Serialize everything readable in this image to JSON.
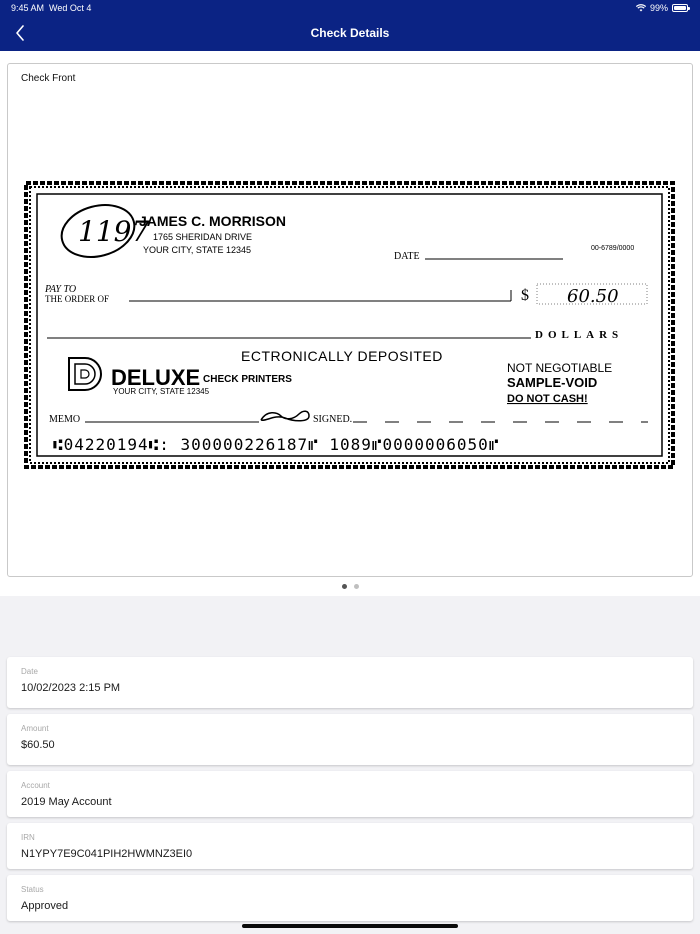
{
  "status_bar": {
    "time": "9:45 AM",
    "date": "Wed Oct 4",
    "battery": "99%"
  },
  "nav": {
    "title": "Check Details",
    "back_icon": "chevron-left-icon"
  },
  "check_image": {
    "label": "Check Front",
    "check": {
      "number": "1197",
      "name": "JAMES C. MORRISON",
      "address1": "1765 SHERIDAN DRIVE",
      "address2": "YOUR CITY, STATE  12345",
      "date_label": "DATE",
      "routing_fraction": "00-6789/0000",
      "pay_to_line1": "PAY TO",
      "pay_to_line2": "THE ORDER OF",
      "dollar_sign": "$",
      "amount": "60.50",
      "dollars_label": "DOLLARS",
      "stamp": "ECTRONICALLY DEPOSITED",
      "bank_name": "DELUXE",
      "bank_sub": "CHECK PRINTERS",
      "bank_city": "YOUR CITY, STATE 12345",
      "void1": "NOT NEGOTIABLE",
      "void2": "SAMPLE-VOID",
      "void3": "DO  NOT  CASH!",
      "memo_label": "MEMO",
      "signed_label": "SIGNED.",
      "micr": "⑆04220194⑆: 300000226187⑈   1089⑈0000006050⑈"
    },
    "pages": 2,
    "active_page": 1
  },
  "fields": [
    {
      "label": "Date",
      "value": "10/02/2023 2:15 PM"
    },
    {
      "label": "Amount",
      "value": "$60.50"
    },
    {
      "label": "Account",
      "value": "2019 May Account"
    },
    {
      "label": "IRN",
      "value": "N1YPY7E9C041PIH2HWMNZ3EI0"
    },
    {
      "label": "Status",
      "value": "Approved"
    }
  ]
}
